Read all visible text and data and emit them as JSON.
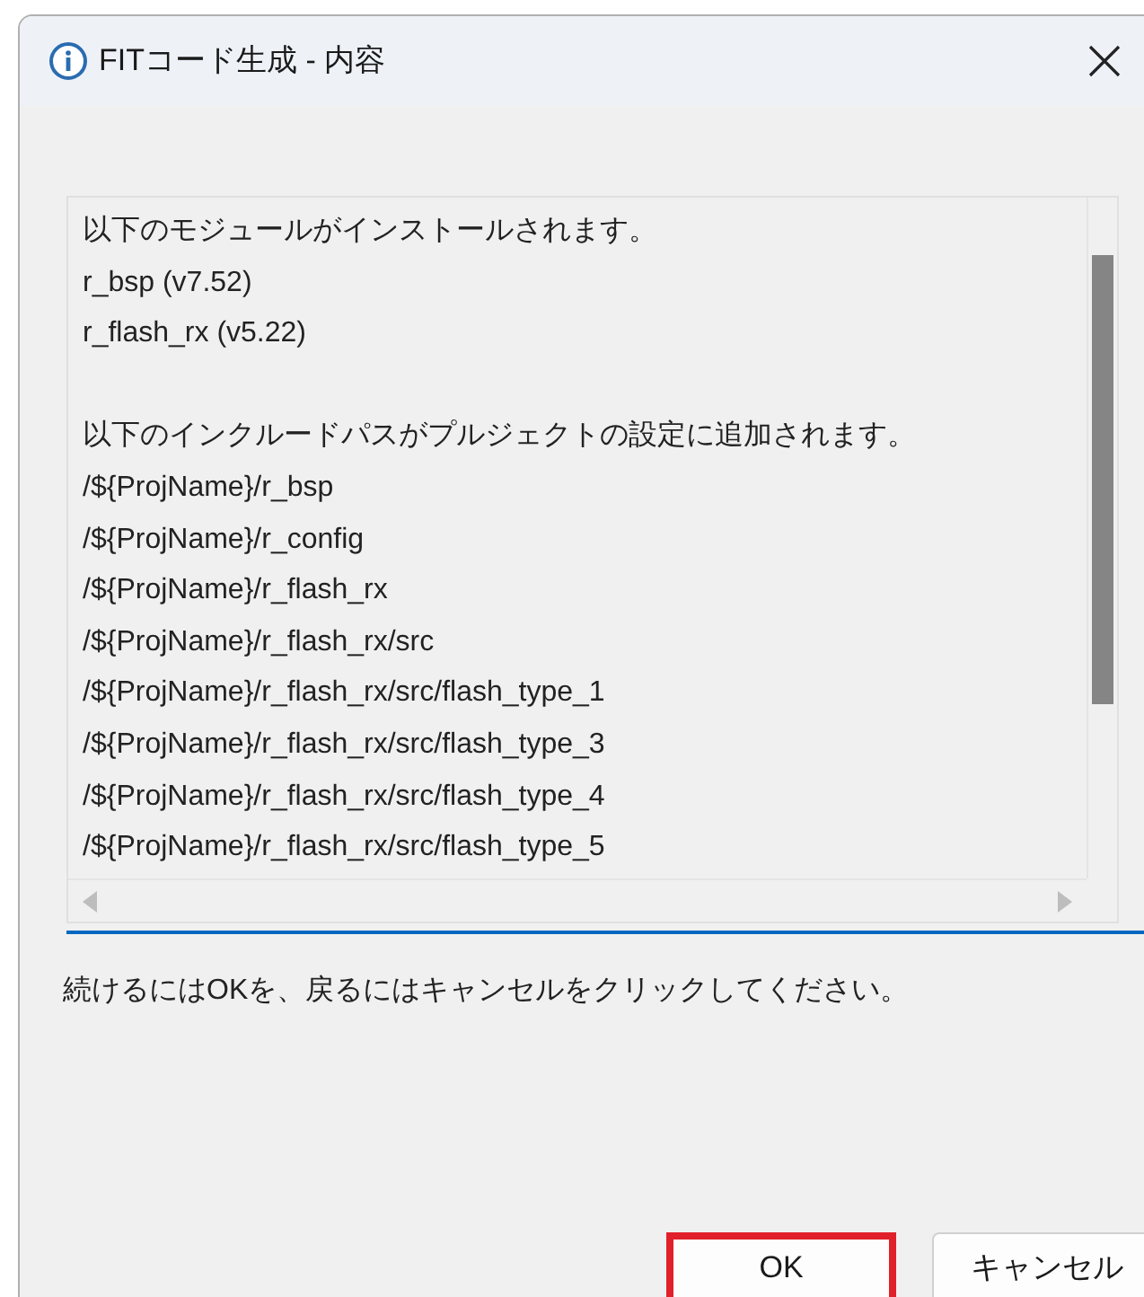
{
  "window": {
    "title": "FITコード生成 - 内容"
  },
  "content": {
    "sections": [
      {
        "heading": "以下のモジュールがインストールされます。",
        "lines": [
          "r_bsp (v7.52)",
          "r_flash_rx (v5.22)"
        ]
      },
      {
        "heading": "以下のインクルードパスがプルジェクトの設定に追加されます。",
        "lines": [
          "/${ProjName}/r_bsp",
          "/${ProjName}/r_config",
          "/${ProjName}/r_flash_rx",
          "/${ProjName}/r_flash_rx/src",
          "/${ProjName}/r_flash_rx/src/flash_type_1",
          "/${ProjName}/r_flash_rx/src/flash_type_3",
          "/${ProjName}/r_flash_rx/src/flash_type_4",
          "/${ProjName}/r_flash_rx/src/flash_type_5"
        ]
      }
    ]
  },
  "message": "続けるにはOKを、戻るにはキャンセルをクリックしてください。",
  "buttons": [
    {
      "label": "OK",
      "highlighted": true
    },
    {
      "label": "キャンセル",
      "highlighted": false
    }
  ]
}
